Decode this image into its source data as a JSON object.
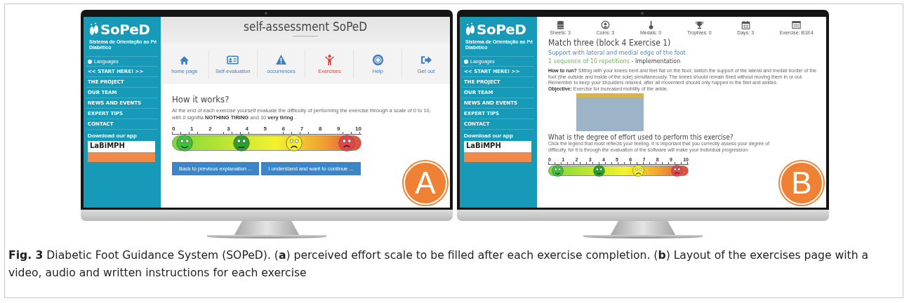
{
  "screens": [
    {
      "badge": "A",
      "sidebar": {
        "logo": "SoPeD",
        "subtitle": "Sistema de Orientação ao Pé Diabético",
        "languages": "Languages",
        "items": [
          "<< START HERE! >>",
          "THE PROJECT",
          "OUR TEAM",
          "NEWS AND EVENTS",
          "EXPERT TIPS",
          "CONTACT"
        ],
        "download": "Download our app",
        "app_logo": "LaBiMPH"
      },
      "title": "self-assessment SoPeD",
      "nav": [
        {
          "label": "home page",
          "selected": false
        },
        {
          "label": "Self-evaluation",
          "selected": false
        },
        {
          "label": "occurrences",
          "selected": false
        },
        {
          "label": "Exercises",
          "selected": true
        },
        {
          "label": "Help",
          "selected": false
        },
        {
          "label": "Get out",
          "selected": false
        }
      ],
      "heading": "How it works?",
      "text": "At the end of each exercise yourself evaluate the difficulty of performing the exercise through a scale of 0 to 10, with 0 signifia **NOTHING TIRING** and 10 **very tiring** .",
      "scale_labels": [
        "0",
        "1",
        "2",
        "3",
        "4",
        "5",
        "6",
        "7",
        "8",
        "9",
        "10"
      ],
      "buttons": [
        "Back to previous explanation ...",
        "I understand and want to continue ..."
      ]
    },
    {
      "badge": "B",
      "sidebar": {
        "logo": "SoPeD",
        "subtitle": "Sistema de Orientação ao Pé Diabético",
        "languages": "Languages",
        "items": [
          "<< START HERE! >>",
          "THE PROJECT",
          "OUR TEAM",
          "NEWS AND EVENTS",
          "EXPERT TIPS",
          "CONTACT"
        ],
        "download": "Download our app",
        "app_logo": "LaBiMPH"
      },
      "stats": [
        "Sheets: 3",
        "Coins: 3",
        "Medals: 0",
        "Trophies: 0",
        "Days: 3",
        "Exercise: B1E4"
      ],
      "title": "Match three (block 4 Exercise 1)",
      "subtitle": "Support with lateral and medial edge of the foot",
      "repetitions": "1 sequence of 10 repetitions",
      "phase": " - Implementation",
      "instructions": "**How to run?** Sitting with your knees bent and feet flat on the floor, switch the support of the lateral and medial border of the foot (the outside and inside of the sole) simultaneously. The knees should remain fixed without moving them in or out. Remember to keep your shoulders relaxed, after all movement should only happen in the feet and ankles.",
      "objective": "**Objective:** Exercise for increased mobility of the ankle.",
      "question": "What is the degree of effort used to perform this exercise?",
      "hint": "Click the legend that most reflects your feeling. It is important that you correctly assess your degree of difficulty, for it is through the evaluation of the software will make your individual progression.",
      "scale_labels": [
        "0",
        "1",
        "2",
        "3",
        "4",
        "5",
        "6",
        "7",
        "8",
        "9",
        "10"
      ]
    }
  ],
  "caption": "**Fig. 3** Diabetic Foot Guidance System (SOPeD). (**a**) perceived effort scale to be filled after each exercise completion. (**b**) Layout of the exercises page with a video, audio and written instructions for each exercise"
}
